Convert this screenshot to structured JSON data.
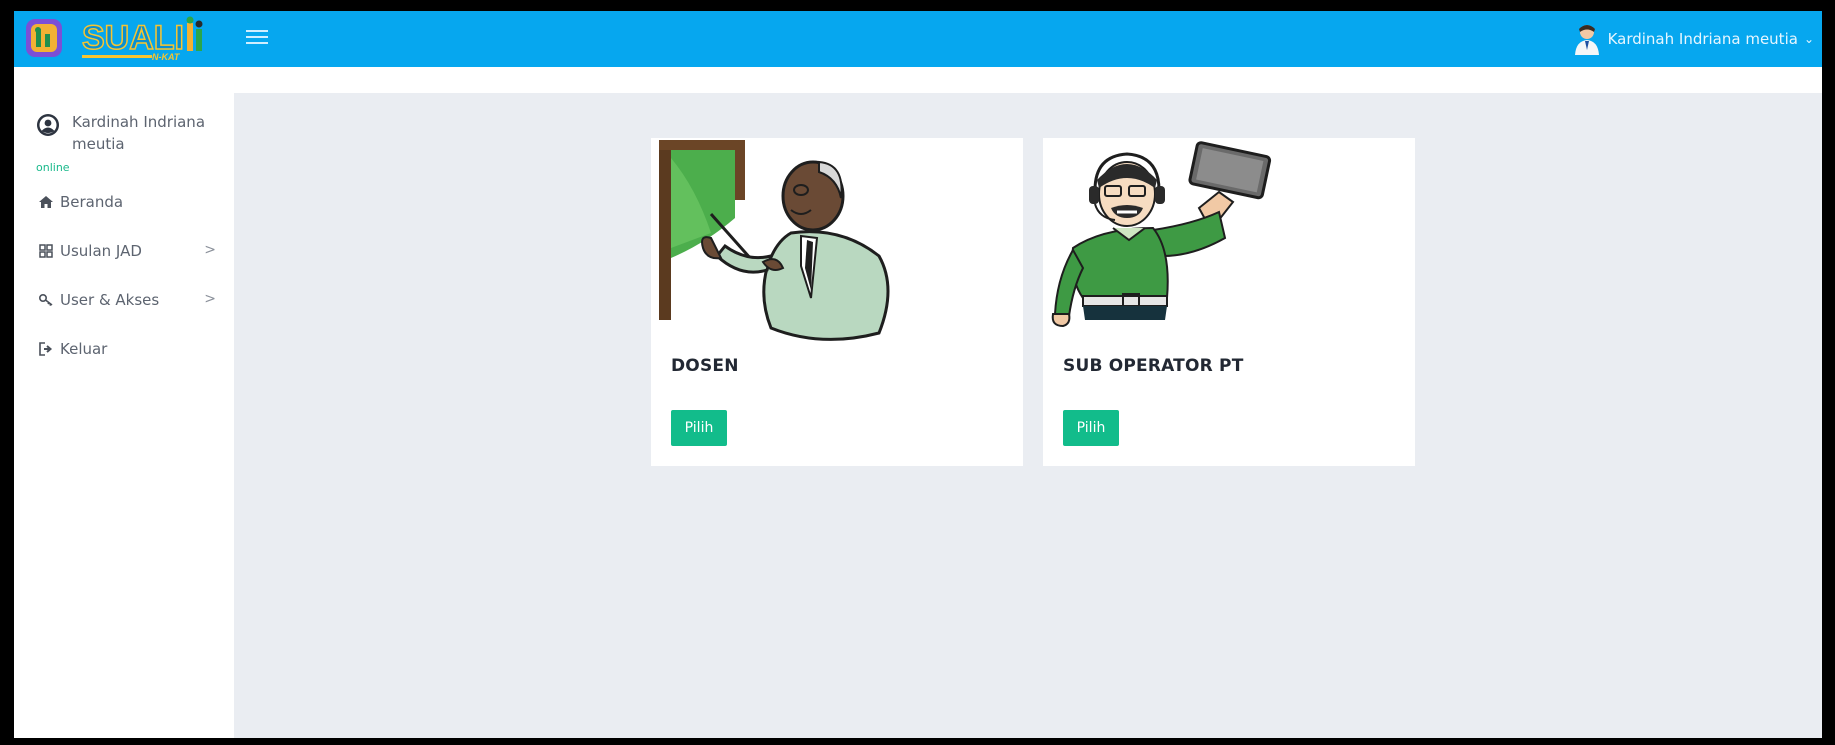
{
  "app": {
    "logo_text": "SUALI",
    "logo_sub": "N-KAT"
  },
  "header": {
    "user_name": "Kardinah Indriana meutia"
  },
  "sidebar": {
    "profile_name": "Kardinah Indriana meutia",
    "status": "online",
    "items": [
      {
        "label": "Beranda",
        "icon": "home-icon"
      },
      {
        "label": "Usulan JAD",
        "icon": "grid-icon",
        "submenu": true
      },
      {
        "label": "User & Akses",
        "icon": "key-icon",
        "submenu": true
      },
      {
        "label": "Keluar",
        "icon": "sign-out-icon"
      }
    ]
  },
  "roles": [
    {
      "title": "DOSEN",
      "button": "Pilih",
      "illustration": "lecturer-illustration"
    },
    {
      "title": "SUB OPERATOR PT",
      "button": "Pilih",
      "illustration": "operator-illustration"
    }
  ],
  "colors": {
    "topbar": "#06a7ef",
    "accent_button": "#12bc8b",
    "status_online": "#19b98b",
    "content_bg": "#eaedf2"
  }
}
